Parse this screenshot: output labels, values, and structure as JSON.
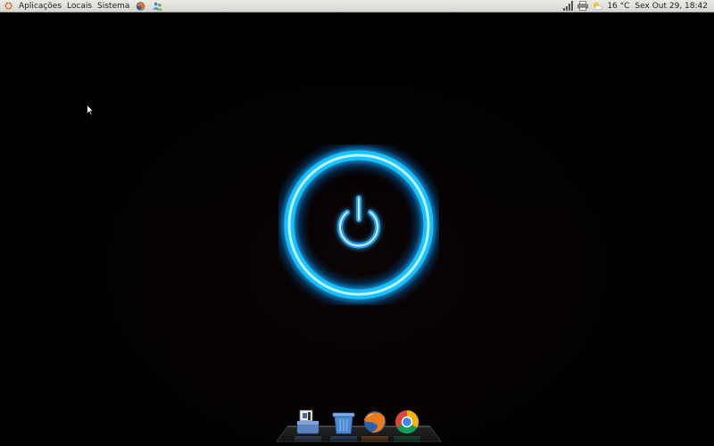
{
  "top_panel": {
    "menus": [
      "Aplicações",
      "Locais",
      "Sistema"
    ],
    "launchers": [
      "firefox-icon",
      "people-icon"
    ],
    "tray": {
      "icons": [
        "network-signal-icon",
        "printer-icon"
      ],
      "weather": "16 °C",
      "datetime": "Sex Out 29, 18:42"
    }
  },
  "dock": {
    "items": [
      "documents-icon",
      "trash-icon",
      "firefox-icon",
      "chrome-icon"
    ]
  },
  "colors": {
    "panel_bg": "#e4e3de",
    "power_glow": "#12b4ff",
    "desktop_bg": "#000000"
  }
}
